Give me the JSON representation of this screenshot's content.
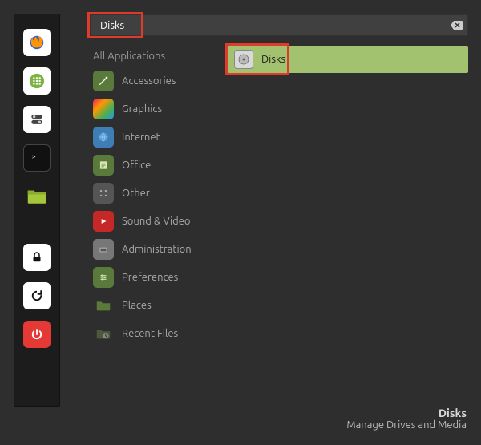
{
  "search": {
    "value": "Disks"
  },
  "categories": {
    "header": "All Applications",
    "items": [
      {
        "label": "Accessories",
        "icon": "accessories"
      },
      {
        "label": "Graphics",
        "icon": "graphics"
      },
      {
        "label": "Internet",
        "icon": "internet"
      },
      {
        "label": "Office",
        "icon": "office"
      },
      {
        "label": "Other",
        "icon": "other"
      },
      {
        "label": "Sound & Video",
        "icon": "sound-video"
      },
      {
        "label": "Administration",
        "icon": "administration"
      },
      {
        "label": "Preferences",
        "icon": "preferences"
      },
      {
        "label": "Places",
        "icon": "places"
      },
      {
        "label": "Recent Files",
        "icon": "recent"
      }
    ]
  },
  "results": {
    "items": [
      {
        "label": "Disks",
        "icon": "disks"
      }
    ]
  },
  "panel": {
    "items": [
      "firefox",
      "apps-grid",
      "toggle",
      "terminal",
      "files",
      "lock",
      "reload",
      "power"
    ]
  },
  "footer": {
    "title": "Disks",
    "subtitle": "Manage Drives and Media"
  }
}
